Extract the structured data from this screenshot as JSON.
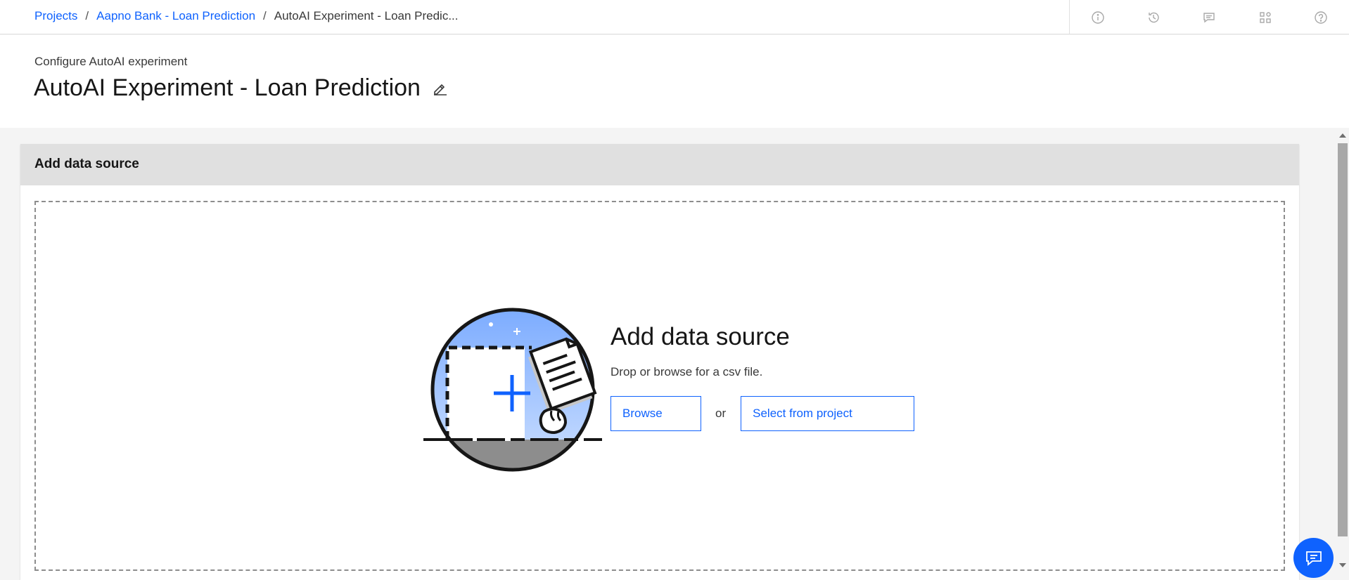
{
  "breadcrumb": {
    "items": [
      {
        "label": "Projects"
      },
      {
        "label": "Aapno Bank - Loan Prediction"
      }
    ],
    "separator": "/",
    "current": "AutoAI Experiment - Loan Predic..."
  },
  "topbar": {
    "icons": [
      "info-icon",
      "history-icon",
      "comment-icon",
      "apps-icon",
      "help-icon"
    ]
  },
  "header": {
    "subtitle": "Configure AutoAI experiment",
    "title": "AutoAI Experiment - Loan Prediction",
    "edit_icon": "pencil-icon"
  },
  "panel": {
    "title": "Add data source",
    "dropzone": {
      "title": "Add data source",
      "description": "Drop or browse for a csv file.",
      "browse_label": "Browse",
      "or_label": "or",
      "select_label": "Select from project"
    }
  },
  "chat": {
    "icon": "chat-icon"
  },
  "colors": {
    "accent": "#0f62fe",
    "header_gray": "#e0e0e0",
    "background": "#f4f4f4",
    "illustration_sky": "#8fb4ff"
  }
}
